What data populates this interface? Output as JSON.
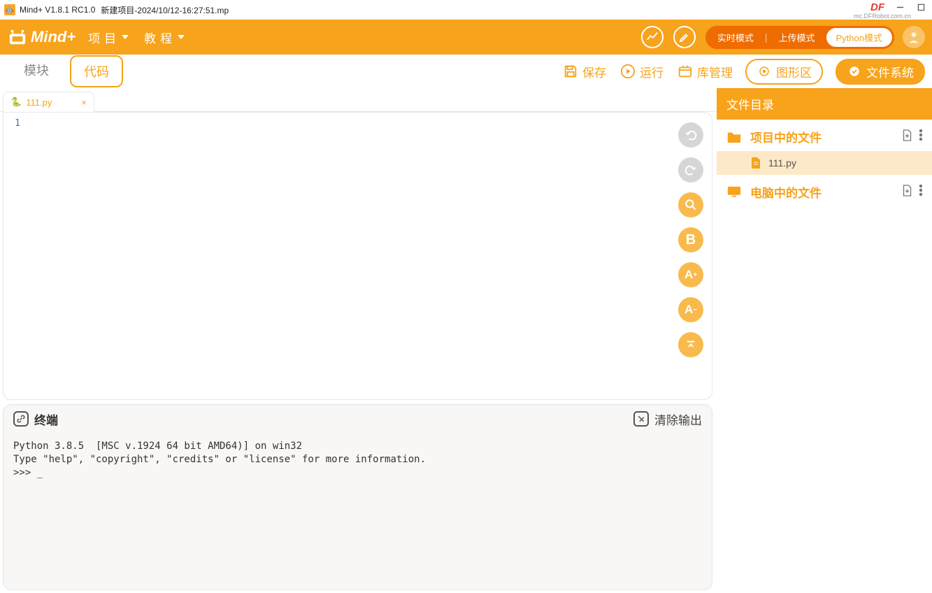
{
  "titlebar": {
    "app": "Mind+ V1.8.1 RC1.0",
    "file": "新建项目-2024/10/12-16:27:51.mp",
    "brand": "DF",
    "brand_sub": "mc.DFRobot.com.cn"
  },
  "header": {
    "logo": "Mind+",
    "menus": [
      "项目",
      "教程"
    ],
    "modes": {
      "realtime": "实时模式",
      "upload": "上传模式",
      "python": "Python模式",
      "active": "python"
    }
  },
  "toolbar": {
    "tabs": {
      "module": "模块",
      "code": "代码",
      "active": "code"
    },
    "save": "保存",
    "run": "运行",
    "lib": "库管理",
    "graph": "图形区",
    "files": "文件系统"
  },
  "editor": {
    "tab": {
      "name": "111.py"
    },
    "line1": "1"
  },
  "terminal": {
    "title": "终端",
    "clear": "清除输出",
    "lines": "Python 3.8.5  [MSC v.1924 64 bit AMD64)] on win32\nType \"help\", \"copyright\", \"credits\" or \"license\" for more information.\n>>> _"
  },
  "filepanel": {
    "title": "文件目录",
    "project_section": "项目中的文件",
    "project_file": "111.py",
    "computer_section": "电脑中的文件"
  }
}
